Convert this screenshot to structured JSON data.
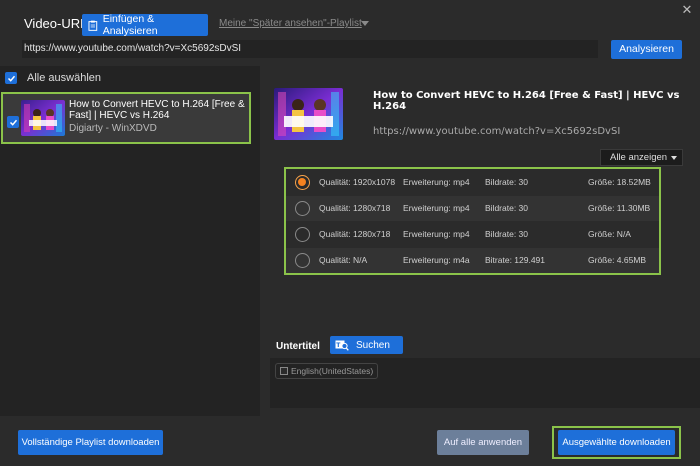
{
  "header": {
    "url_label": "Video-URL",
    "paste_button": "Einfügen & Analysieren",
    "watch_later_link": "Meine \"Später ansehen\"-Playlist",
    "url_value": "https://www.youtube.com/watch?v=Xc5692sDvSI",
    "analyze_button": "Analysieren",
    "close_symbol": "✕"
  },
  "video_list": {
    "select_all_label": "Alle auswählen",
    "items": [
      {
        "title": "How to Convert HEVC to H.264 [Free & Fast] | HEVC vs H.264",
        "source": "Digiarty - WinXDVD",
        "checked": true
      }
    ]
  },
  "details": {
    "title": "How to Convert HEVC to H.264 [Free & Fast] | HEVC vs H.264",
    "url": "https://www.youtube.com/watch?v=Xc5692sDvSI",
    "show_all_label": "Alle anzeigen",
    "thumbnail_caption": "CONVERT HEVC TO H.264 FREE & FAST",
    "formats": [
      {
        "quality": "Qualität: 1920x1078",
        "ext": "Erweiterung: mp4",
        "rate": "Bildrate: 30",
        "size": "Größe: 18.52MB",
        "selected": true
      },
      {
        "quality": "Qualität: 1280x718",
        "ext": "Erweiterung: mp4",
        "rate": "Bildrate: 30",
        "size": "Größe: 11.30MB",
        "selected": false
      },
      {
        "quality": "Qualität: 1280x718",
        "ext": "Erweiterung: mp4",
        "rate": "Bildrate: 30",
        "size": "Größe: N/A",
        "selected": false
      },
      {
        "quality": "Qualität: N/A",
        "ext": "Erweiterung: m4a",
        "rate": "Bitrate: 129.491",
        "size": "Größe: 4.65MB",
        "selected": false
      }
    ]
  },
  "subtitles": {
    "label": "Untertitel",
    "search_button": "Suchen",
    "items": [
      {
        "label": "English(UnitedStates)",
        "checked": false
      }
    ]
  },
  "footer": {
    "playlist_button": "Vollständige Playlist downloaden",
    "apply_all_button": "Auf alle anwenden",
    "download_button": "Ausgewählte downloaden"
  },
  "colors": {
    "accent_blue": "#1e6fd9",
    "highlight_green": "#8bc34a",
    "radio_orange": "#f58220"
  },
  "icons": [
    "paste-icon",
    "chevron-down-icon",
    "close-icon",
    "checkbox-checked-icon",
    "subtitle-search-icon"
  ]
}
